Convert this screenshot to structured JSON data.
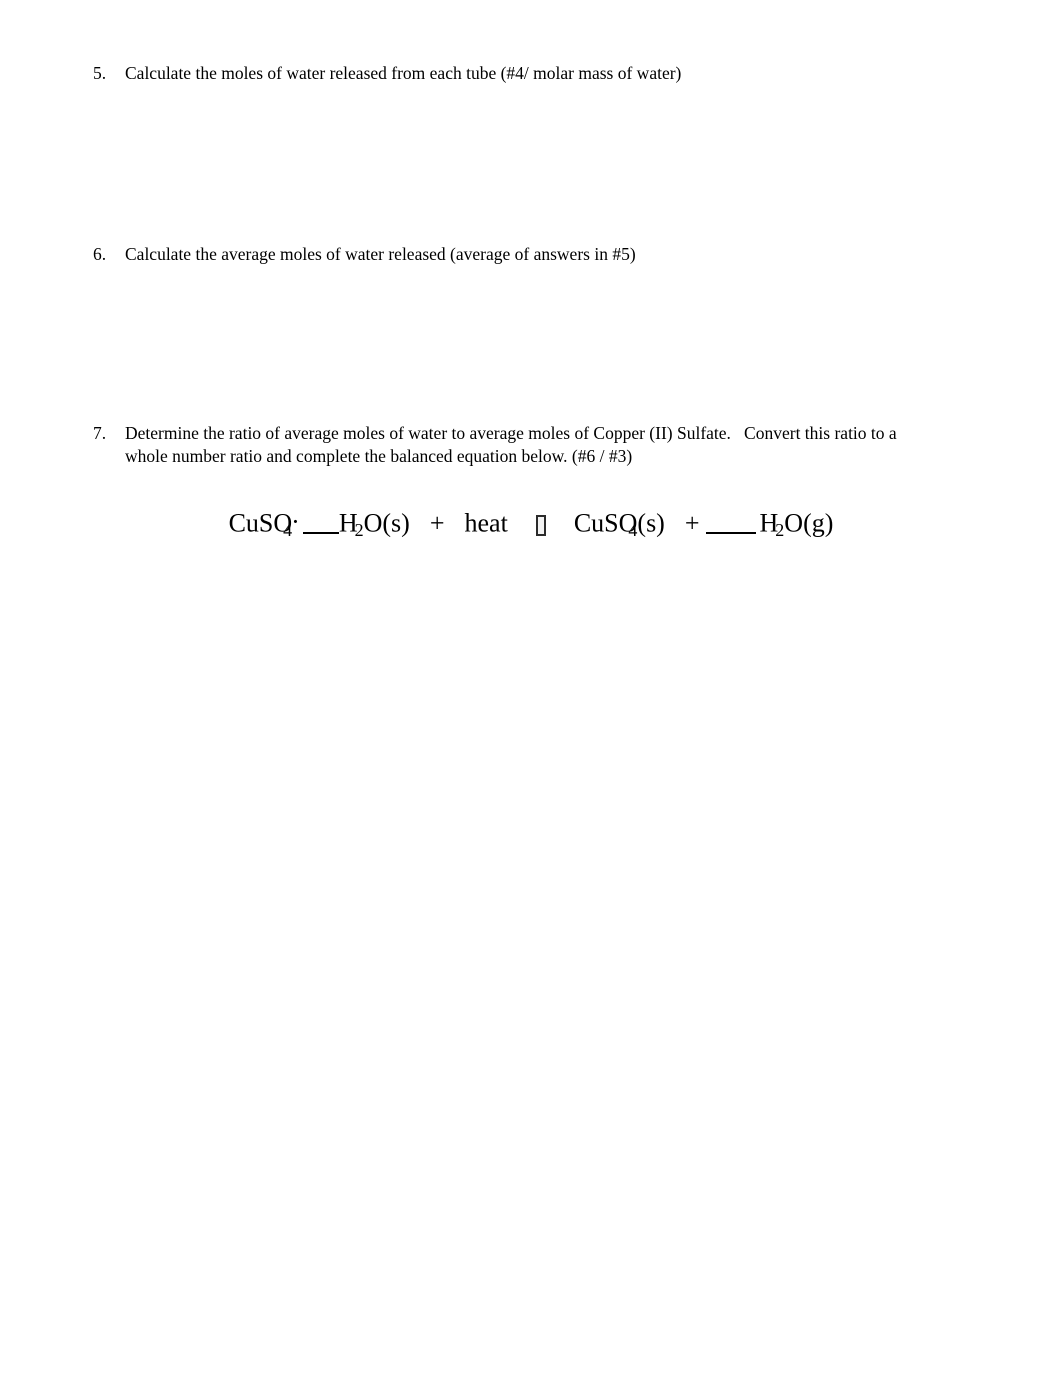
{
  "document": {
    "background_color": "#ffffff",
    "text_color": "#000000"
  },
  "items": [
    {
      "number": "5.",
      "lines": [
        "Calculate the moles of water released from each tube (#4/ molar mass of water)"
      ]
    },
    {
      "number": "6.",
      "lines": [
        "Calculate the average moles of water released (average of answers in #5)"
      ]
    },
    {
      "number": "7.",
      "lines": [
        "Determine the ratio of average moles of water to average moles of Copper (II) Sulfate.   Convert this ratio to a",
        "whole number ratio and complete the balanced equation below. (#6 / #3)"
      ]
    }
  ],
  "equation": {
    "reactant_formula": "CuSO",
    "reactant_subscript": "4",
    "hydrate_dot": "·",
    "water_reactant": "H",
    "water_reactant_subscript": "2",
    "water_reactant_rest": "O(s)",
    "plus_1": "+",
    "heat_label": "heat",
    "arrow_glyph": "missing-glyph-box",
    "product_formula": "CuSO",
    "product_subscript": "4",
    "product_state": "(s)",
    "plus_2": "+",
    "water_product": "H",
    "water_product_subscript": "2",
    "water_product_rest": "O(g)",
    "blank_1_label": "",
    "blank_2_label": ""
  }
}
